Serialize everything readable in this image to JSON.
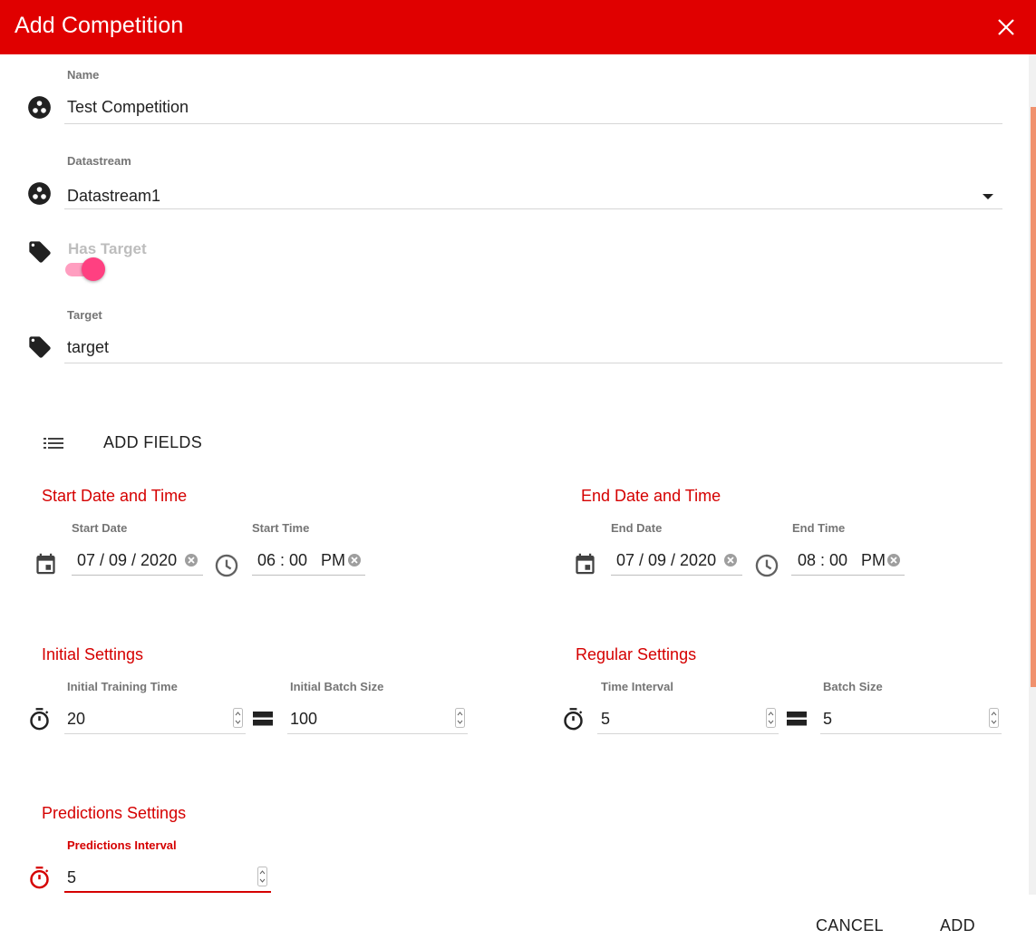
{
  "dialog": {
    "title": "Add Competition"
  },
  "colors": {
    "header": "#e00000",
    "accent": "#d50000",
    "toggle": "#ff4081",
    "scrollbar": "#f0916e"
  },
  "form": {
    "name": {
      "label": "Name",
      "value": "Test Competition",
      "icon": "scatter-dots-icon"
    },
    "datastream": {
      "label": "Datastream",
      "value": "Datastream1",
      "icon": "scatter-dots-icon"
    },
    "has_target": {
      "label": "Has Target",
      "checked": true,
      "icon": "tag-icon"
    },
    "target": {
      "label": "Target",
      "value": "target",
      "icon": "tag-icon"
    },
    "add_fields": {
      "label": "ADD FIELDS",
      "icon": "list-icon"
    }
  },
  "start": {
    "heading": "Start Date and Time",
    "date_label": "Start Date",
    "date_value": "07 / 09 / 2020",
    "time_label": "Start Time",
    "time_value": "06 : 00   PM"
  },
  "end": {
    "heading": "End Date and Time",
    "date_label": "End Date",
    "date_value": "07 / 09 / 2020",
    "time_label": "End Time",
    "time_value": "08 : 00   PM"
  },
  "initial": {
    "heading": "Initial Settings",
    "training_time_label": "Initial Training Time",
    "training_time_value": "20",
    "batch_size_label": "Initial Batch Size",
    "batch_size_value": "100"
  },
  "regular": {
    "heading": "Regular Settings",
    "time_interval_label": "Time Interval",
    "time_interval_value": "5",
    "batch_size_label": "Batch Size",
    "batch_size_value": "5"
  },
  "predictions": {
    "heading": "Predictions Settings",
    "interval_label": "Predictions Interval",
    "interval_value": "5"
  },
  "actions": {
    "cancel": "CANCEL",
    "add": "ADD"
  }
}
